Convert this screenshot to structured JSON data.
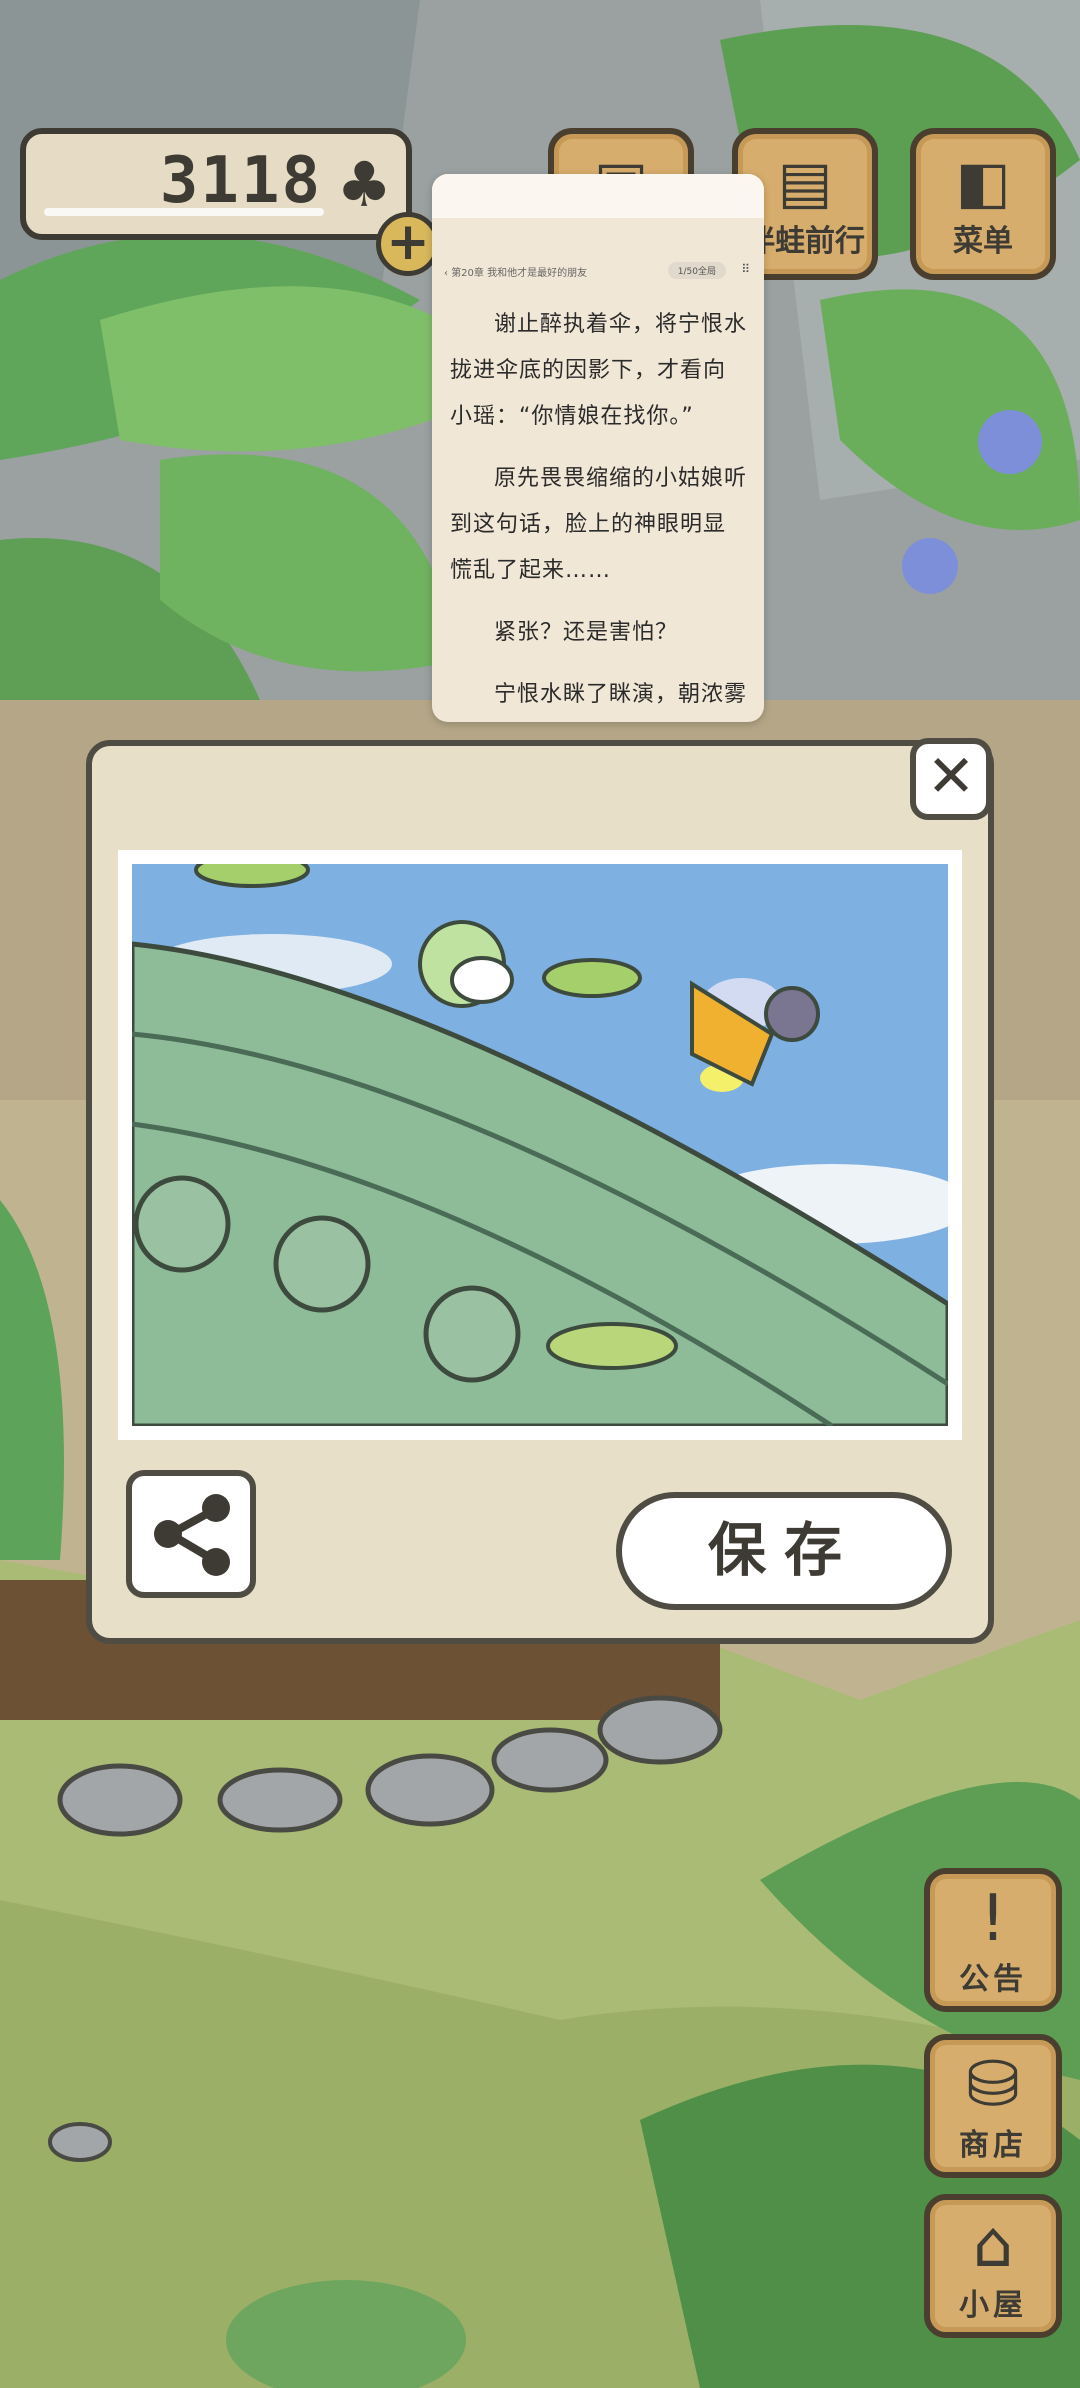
{
  "currency": {
    "amount": "3118",
    "icon": "clover-icon"
  },
  "top_buttons": [
    {
      "label": "伴蛙前行",
      "icon": "stamp-icon"
    },
    {
      "label": "菜单",
      "icon": "menu-icon"
    }
  ],
  "reader": {
    "chapter": "第20章 我和他才是最好的朋友",
    "pill": "1/50全局",
    "paragraphs": [
      "谢止醉执着伞，将宁恨水拢进伞底的因影下，才看向小瑶：“你情娘在找你。”",
      "原先畏畏缩缩的小姑娘听到这句话，脸上的神眼明显慌乱了起来……",
      "紧张？还是害怕？",
      "宁恨水眯了眯演，朝浓雾"
    ]
  },
  "dialog": {
    "save_label": "保存",
    "share_icon": "share-icon",
    "close_icon": "close-icon"
  },
  "side_buttons": [
    {
      "label": "公告",
      "icon": "exclamation-icon"
    },
    {
      "label": "商店",
      "icon": "bags-icon"
    },
    {
      "label": "小屋",
      "icon": "house-icon"
    }
  ]
}
